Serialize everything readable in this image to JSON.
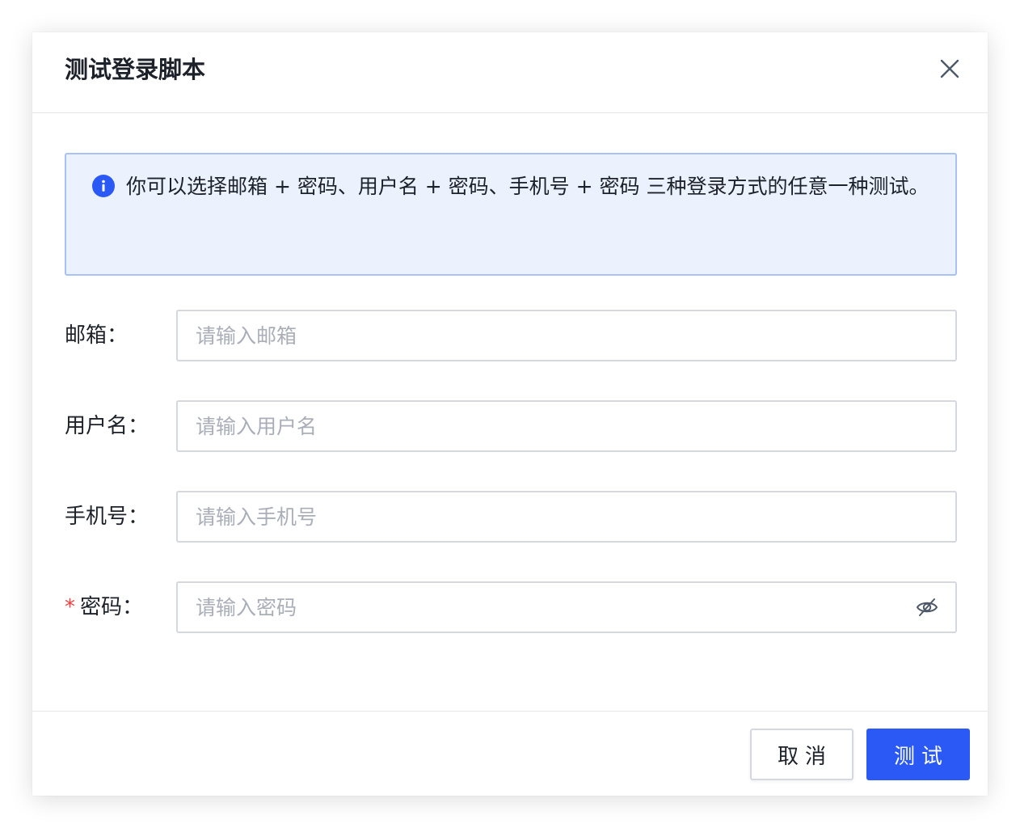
{
  "dialog": {
    "title": "测试登录脚本"
  },
  "alert": {
    "text": "你可以选择邮箱 + 密码、用户名 + 密码、手机号 + 密码 三种登录方式的任意一种测试。",
    "icon": "info-icon",
    "accent_color": "#2b59f5"
  },
  "form": {
    "email": {
      "label": "邮箱：",
      "placeholder": "请输入邮箱",
      "value": ""
    },
    "username": {
      "label": "用户名：",
      "placeholder": "请输入用户名",
      "value": ""
    },
    "phone": {
      "label": "手机号：",
      "placeholder": "请输入手机号",
      "value": ""
    },
    "password": {
      "required_mark": "*",
      "label": "密码：",
      "placeholder": "请输入密码",
      "value": "",
      "visibility_icon": "eye-off-icon"
    }
  },
  "footer": {
    "cancel_label": "取消",
    "submit_label": "测试"
  },
  "colors": {
    "primary": "#2b59f5",
    "alert_bg": "#ebf1fd",
    "alert_border": "#a9c1f5",
    "required": "#f53f3f"
  }
}
